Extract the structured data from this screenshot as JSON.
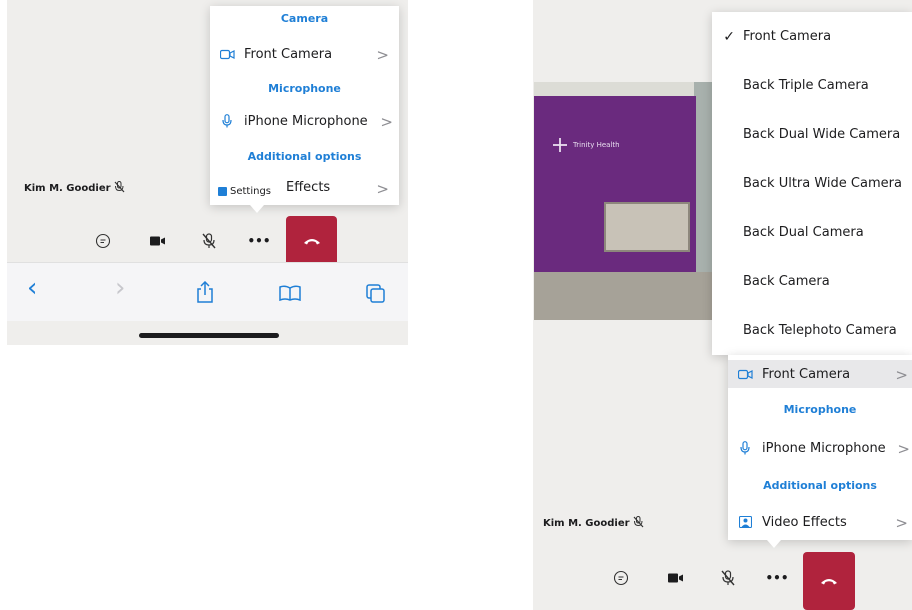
{
  "left": {
    "menu": {
      "camera_section": "Camera",
      "camera_item": "Front Camera",
      "microphone_section": "Microphone",
      "microphone_item": "iPhone Microphone",
      "additional_section": "Additional options",
      "effects_item": "Effects",
      "settings_tooltip": "Settings"
    },
    "participant_name": "Kim M. Goodier",
    "toolbar": {
      "chat": "chat-icon",
      "video": "video-icon",
      "mic": "mic-muted-icon",
      "more": "•••",
      "hangup": "hangup-icon"
    },
    "safari": {
      "back": "‹",
      "forward": "›",
      "share": "share-icon",
      "bookmarks": "book-icon",
      "tabs": "tabs-icon"
    }
  },
  "right": {
    "camera_options": [
      {
        "label": "Front Camera",
        "selected": true
      },
      {
        "label": "Back Triple Camera",
        "selected": false
      },
      {
        "label": "Back Dual Wide Camera",
        "selected": false
      },
      {
        "label": "Back Ultra Wide Camera",
        "selected": false
      },
      {
        "label": "Back Dual Camera",
        "selected": false
      },
      {
        "label": "Back Camera",
        "selected": false
      },
      {
        "label": "Back Telephoto Camera",
        "selected": false
      }
    ],
    "check_mark": "✓",
    "video_wall_text": "Trinity Health",
    "menu": {
      "camera_item": "Front Camera",
      "microphone_section": "Microphone",
      "microphone_item": "iPhone Microphone",
      "additional_section": "Additional options",
      "effects_item": "Video Effects"
    },
    "participant_name": "Kim M. Goodier",
    "toolbar": {
      "more": "•••"
    }
  },
  "colors": {
    "accent_blue": "#1f7fd6",
    "hangup_red": "#b0233d",
    "wall_purple": "#6a2a7e"
  }
}
